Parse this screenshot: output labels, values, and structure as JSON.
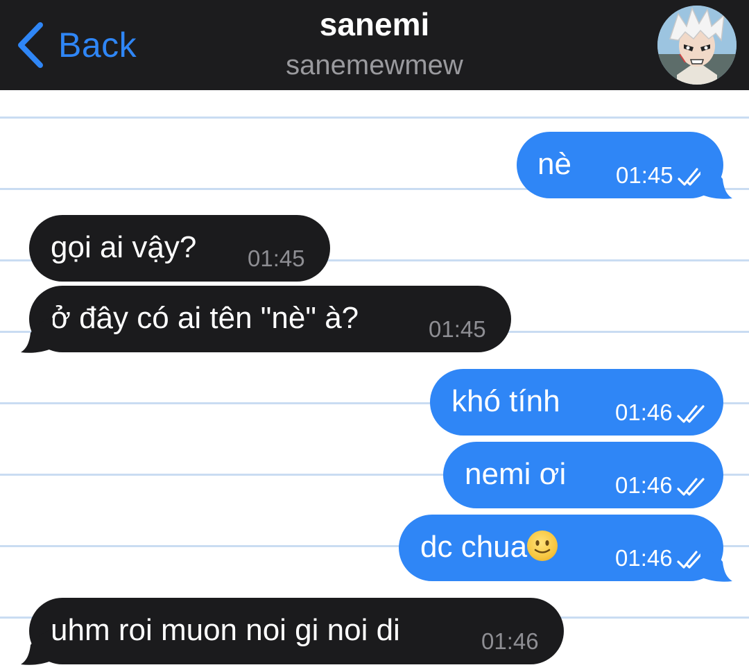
{
  "header": {
    "back_label": "Back",
    "title": "sanemi",
    "subtitle": "sanemewmew"
  },
  "colors": {
    "outgoing": "#2f86f6",
    "incoming": "#1b1b1d",
    "header_bg": "#1c1c1e",
    "accent": "#2f86f6"
  },
  "messages": [
    {
      "direction": "outgoing",
      "text": "nè",
      "time": "01:45",
      "status": "read"
    },
    {
      "direction": "incoming",
      "text": "gọi ai vậy?",
      "time": "01:45"
    },
    {
      "direction": "incoming",
      "text": "ở đây có ai tên \"nè\" à?",
      "time": "01:45"
    },
    {
      "direction": "outgoing",
      "text": "khó tính",
      "time": "01:46",
      "status": "read"
    },
    {
      "direction": "outgoing",
      "text": "nemi ơi",
      "time": "01:46",
      "status": "read"
    },
    {
      "direction": "outgoing",
      "text": "dc chua",
      "emoji": "slightly-smiling-face",
      "time": "01:46",
      "status": "read"
    },
    {
      "direction": "incoming",
      "text": "uhm roi muon noi gi noi di",
      "time": "01:46"
    }
  ]
}
